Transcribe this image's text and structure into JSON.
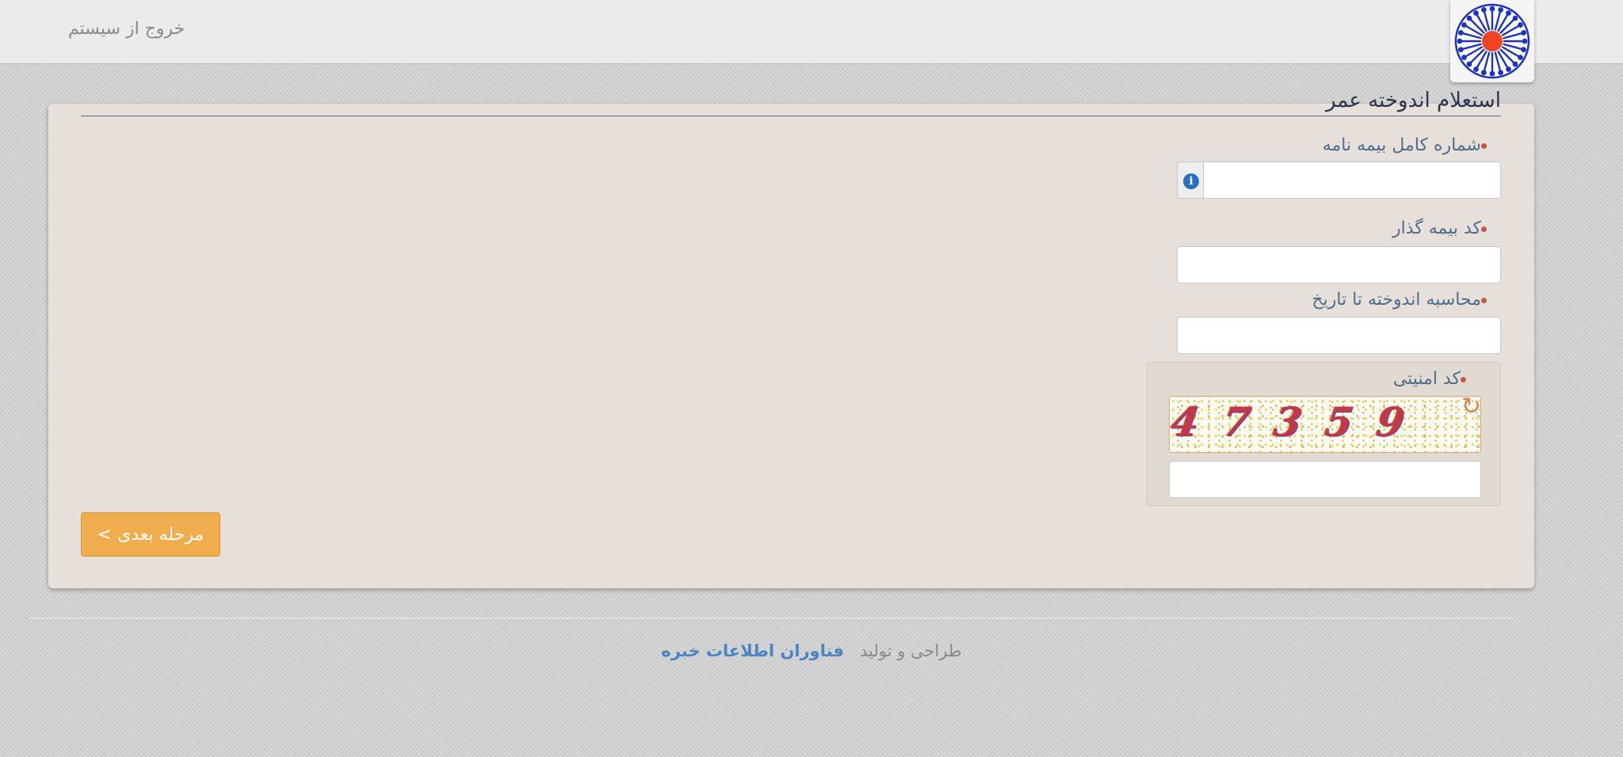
{
  "header": {
    "logout_label": "خروج از سیستم"
  },
  "panel": {
    "title": "استعلام اندوخته عمر"
  },
  "form": {
    "policy_number": {
      "label": "شماره کامل بیمه نامه",
      "value": ""
    },
    "policyholder_code": {
      "label": "کد بیمه گذار",
      "value": ""
    },
    "calc_date": {
      "label": "محاسبه اندوخته تا تاریخ",
      "value": ""
    },
    "captcha": {
      "label": "کد امنیتی",
      "code": "47359",
      "value": ""
    },
    "next_label": "مرحله بعدی >"
  },
  "footer": {
    "prefix": "طراحی و تولید",
    "company": "فناوران اطلاعات خبره"
  },
  "icons": {
    "logo": "emblem-logo",
    "info": "info-icon",
    "refresh": "refresh-icon"
  },
  "colors": {
    "accent_button": "#f0ad4e",
    "required_marker": "#c4574a",
    "label_text": "#4e6e8e",
    "link": "#4b86c2",
    "info_icon": "#2a6fc0",
    "panel_bg": "#e7dfd9"
  }
}
